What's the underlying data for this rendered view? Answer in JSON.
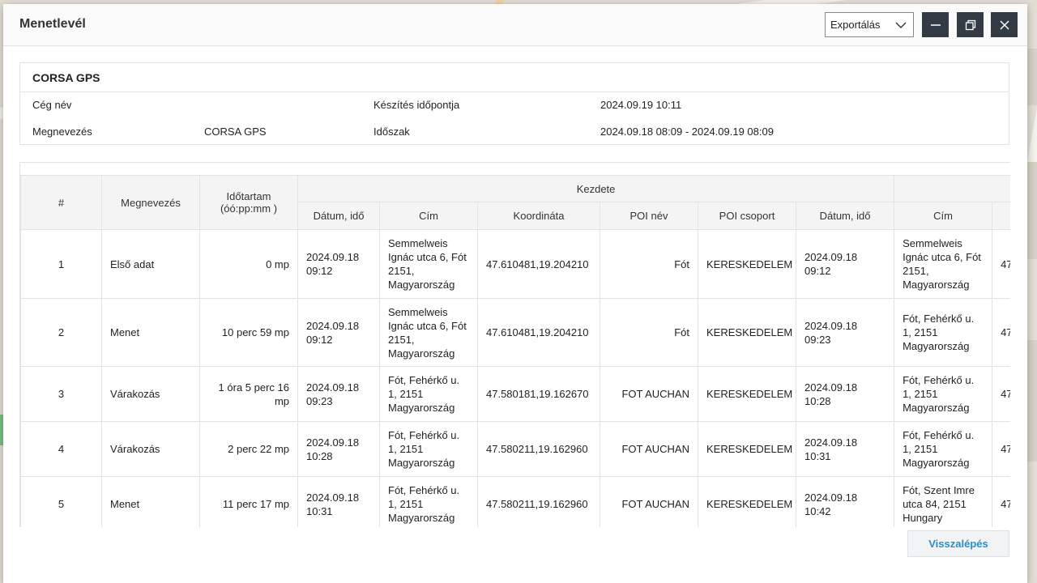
{
  "dialog": {
    "title": "Menetlevél",
    "export_label": "Exportálás",
    "back_label": "Visszalépés"
  },
  "info": {
    "title": "CORSA GPS",
    "company_label": "Cég név",
    "company_value": "",
    "created_label": "Készítés időpontja",
    "created_value": "2024.09.19 10:11",
    "name_label": "Megnevezés",
    "name_value": "CORSA GPS",
    "period_label": "Időszak",
    "period_value": "2024.09.18 08:09 - 2024.09.19 08:09"
  },
  "table": {
    "headers": {
      "num": "#",
      "name": "Megnevezés",
      "duration": "Időtartam (óó:pp:mm )",
      "start_group": "Kezdete",
      "datetime": "Dátum, idő",
      "address": "Cím",
      "coordinate": "Koordináta",
      "poi_name": "POI név",
      "poi_group": "POI csoport",
      "end_datetime": "Dátum, idő",
      "end_address": "Cím"
    },
    "rows": [
      {
        "num": "1",
        "name": "Első adat",
        "duration": "0 mp",
        "start_datetime": "2024.09.18 09:12",
        "start_address": "Semmelweis Ignác utca 6, Fót 2151, Magyarország",
        "coordinate": "47.610481,19.204210",
        "poi_name": "Fót",
        "poi_group": "KERESKEDELEM",
        "end_datetime": "2024.09.18 09:12",
        "end_address": "Semmelweis Ignác utca 6, Fót 2151, Magyarország",
        "end_coord_partial": "47"
      },
      {
        "num": "2",
        "name": "Menet",
        "duration": "10 perc 59 mp",
        "start_datetime": "2024.09.18 09:12",
        "start_address": "Semmelweis Ignác utca 6, Fót 2151, Magyarország",
        "coordinate": "47.610481,19.204210",
        "poi_name": "Fót",
        "poi_group": "KERESKEDELEM",
        "end_datetime": "2024.09.18 09:23",
        "end_address": "Fót, Fehérkő u. 1, 2151 Magyarország",
        "end_coord_partial": "47"
      },
      {
        "num": "3",
        "name": "Várakozás",
        "duration": "1 óra 5 perc 16 mp",
        "start_datetime": "2024.09.18 09:23",
        "start_address": "Fót, Fehérkő u. 1, 2151 Magyarország",
        "coordinate": "47.580181,19.162670",
        "poi_name": "FOT AUCHAN",
        "poi_group": "KERESKEDELEM",
        "end_datetime": "2024.09.18 10:28",
        "end_address": "Fót, Fehérkő u. 1, 2151 Magyarország",
        "end_coord_partial": "47"
      },
      {
        "num": "4",
        "name": "Várakozás",
        "duration": "2 perc 22 mp",
        "start_datetime": "2024.09.18 10:28",
        "start_address": "Fót, Fehérkő u. 1, 2151 Magyarország",
        "coordinate": "47.580211,19.162960",
        "poi_name": "FOT AUCHAN",
        "poi_group": "KERESKEDELEM",
        "end_datetime": "2024.09.18 10:31",
        "end_address": "Fót, Fehérkő u. 1, 2151 Magyarország",
        "end_coord_partial": "47"
      },
      {
        "num": "5",
        "name": "Menet",
        "duration": "11 perc 17 mp",
        "start_datetime": "2024.09.18 10:31",
        "start_address": "Fót, Fehérkő u. 1, 2151 Magyarország",
        "coordinate": "47.580211,19.162960",
        "poi_name": "FOT AUCHAN",
        "poi_group": "KERESKEDELEM",
        "end_datetime": "2024.09.18 10:42",
        "end_address": "Fót, Szent Imre utca 84, 2151 Hungary",
        "end_coord_partial": "47"
      }
    ]
  },
  "icons": {
    "export_chevron": "chevron-down-icon",
    "minimize": "minimize-icon",
    "restore": "restore-window-icon",
    "close": "close-icon"
  },
  "colors": {
    "window_button": "#333b45",
    "header_cell": "#f4f4f4",
    "border": "#e3e3e3",
    "link_blue": "#2a8fc4"
  }
}
